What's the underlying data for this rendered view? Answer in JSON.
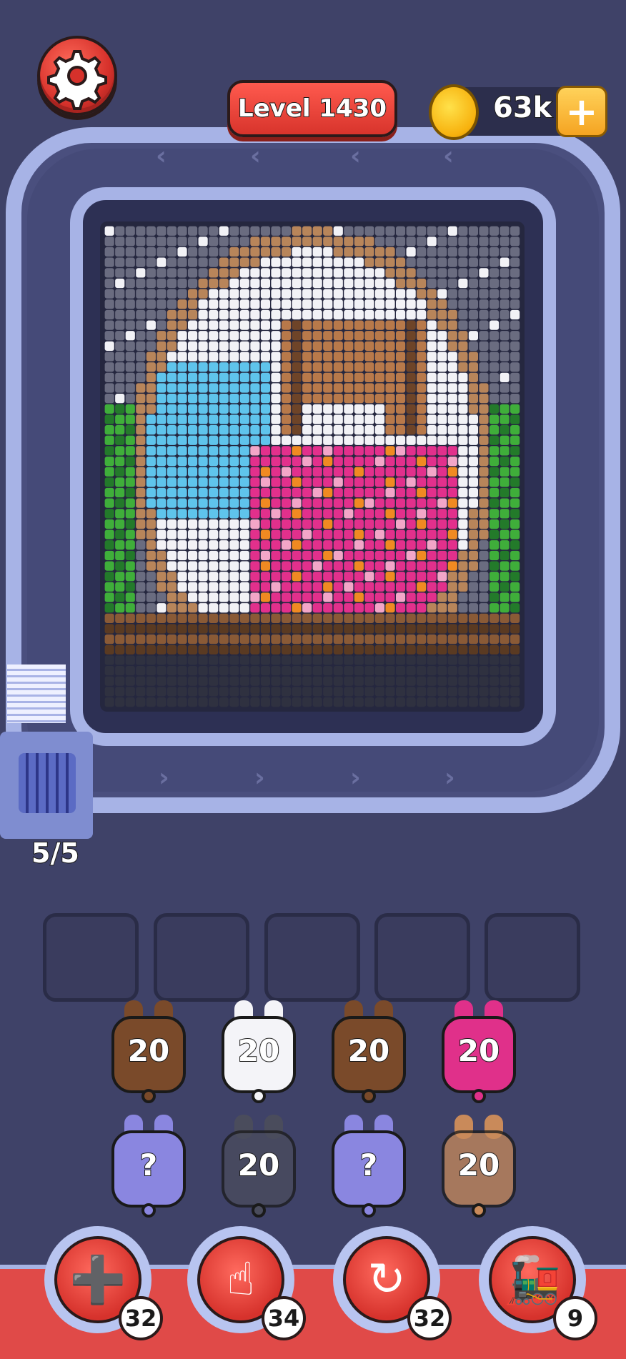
{
  "header": {
    "level_label": "Level 1430",
    "coins": "63k",
    "coin_plus": "+"
  },
  "capacity_label": "5/5",
  "icons": {
    "settings": "gear-icon",
    "coin": "coin-icon",
    "booster_1": "add-slot-icon",
    "booster_2": "hand-pointer-icon",
    "booster_3": "shuffle-icon",
    "booster_4": "train-icon"
  },
  "colors": {
    "brown": "#7a4a2a",
    "white": "#f4f4f8",
    "pink": "#e0308a",
    "purple": "#8a86e0",
    "gray": "#4a4c5c",
    "tan": "#c98a5a"
  },
  "bots": [
    {
      "label": "20",
      "color": "brown"
    },
    {
      "label": "20",
      "color": "white"
    },
    {
      "label": "20",
      "color": "brown"
    },
    {
      "label": "20",
      "color": "pink"
    },
    {
      "label": "?",
      "color": "purple"
    },
    {
      "label": "20",
      "color": "gray"
    },
    {
      "label": "?",
      "color": "purple"
    },
    {
      "label": "20",
      "color": "tan"
    }
  ],
  "boosters": [
    {
      "count": "32",
      "icon": "add-slot-icon"
    },
    {
      "count": "34",
      "icon": "hand-pointer-icon"
    },
    {
      "count": "32",
      "icon": "shuffle-icon"
    },
    {
      "count": "9",
      "icon": "train-icon"
    }
  ]
}
